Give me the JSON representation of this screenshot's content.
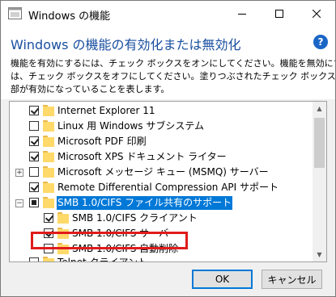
{
  "window": {
    "title": "Windows の機能",
    "heading": "Windows の機能の有効化または無効化",
    "help_label": "?",
    "description_lines": [
      "機能を有効にするには、チェック ボックスをオンにしてください。機能を無効にするに",
      "は、チェック ボックスをオフにしてください。塗りつぶされたチェック ボックスは、機能の一",
      "部が有効になっていることを表します。"
    ]
  },
  "tree": {
    "items": [
      {
        "label": "Internet Explorer 11",
        "state": "checked",
        "expander": ""
      },
      {
        "label": "Linux 用 Windows サブシステム",
        "state": "unchecked",
        "expander": ""
      },
      {
        "label": "Microsoft PDF 印刷",
        "state": "checked",
        "expander": ""
      },
      {
        "label": "Microsoft XPS ドキュメント ライター",
        "state": "checked",
        "expander": ""
      },
      {
        "label": "Microsoft メッセージ キュー (MSMQ) サーバー",
        "state": "unchecked",
        "expander": "+"
      },
      {
        "label": "Remote Differential Compression API サポート",
        "state": "checked",
        "expander": ""
      },
      {
        "label": "SMB 1.0/CIFS ファイル共有のサポート",
        "state": "partial",
        "expander": "−"
      },
      {
        "label": "SMB 1.0/CIFS クライアント",
        "state": "checked",
        "expander": ""
      },
      {
        "label": "SMB 1.0/CIFS サーバー",
        "state": "checked",
        "expander": ""
      },
      {
        "label": "SMB 1.0/CIFS 自動削除",
        "state": "unchecked",
        "expander": ""
      },
      {
        "label": "Telnet クライアント",
        "state": "unchecked",
        "expander": ""
      }
    ]
  },
  "buttons": {
    "ok": "OK",
    "cancel": "キャンセル"
  },
  "colors": {
    "accent": "#0078d7",
    "heading": "#1a4fa0",
    "highlight": "#e11b1b"
  }
}
